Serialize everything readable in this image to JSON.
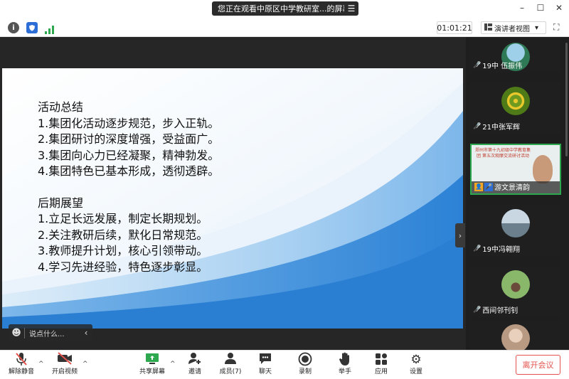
{
  "titlebar": {
    "share_text": "您正在观看中原区中学教研室...的屏幕",
    "menu_icon": "☰",
    "minimize": "–",
    "restore": "☐",
    "close": "✕"
  },
  "infobar": {
    "info_label": "i",
    "timer": "01:01:21",
    "view_label": "演讲者视图",
    "view_caret": "▾",
    "fullscreen": "⛶"
  },
  "slide": {
    "lines": [
      "活动总结",
      "1.集团化活动逐步规范，步入正轨。",
      "2.集团研讨的深度增强，受益面广。",
      "3.集团向心力已经凝聚，精神勃发。",
      "4.集团特色已基本形成，透彻透辟。",
      "后期展望",
      "1.立足长远发展，制定长期规划。",
      "2.关注教研后续，默化日常规范。",
      "3.教师提升计划，核心引领带动。",
      "4.学习先进经验，特色逐步彰显。"
    ],
    "colors": {
      "wave_light": "#dcecf8",
      "wave_mid": "#8ec3ee",
      "wave_dark": "#3b8fdd"
    }
  },
  "chat": {
    "placeholder": "说点什么...",
    "face_icon": "☻",
    "collapse_icon": "‹"
  },
  "gallery": {
    "handle_icon": "›",
    "tiles": [
      {
        "name": "19中 伍振伟",
        "avatar_color": "#2f7a56"
      },
      {
        "name": "21中张军辉",
        "avatar_color": "#6f9a20"
      },
      {
        "name": "游文景清韵",
        "active": true
      },
      {
        "name": "19中冯翱翔",
        "avatar_color": "#6b7f8d"
      },
      {
        "name": "西间邻刊钊",
        "avatar_color": "#8ab86a"
      },
      {
        "name": "",
        "avatar_color": "#b89a82"
      }
    ],
    "active_tile_banner": "郑州市第十九初级中学教育集团 第五次观摩交流研讨活动"
  },
  "toolbar": {
    "items": [
      {
        "label": "解除静音",
        "icon": "🎙"
      },
      {
        "label": "开启视频",
        "icon": "▭"
      },
      {
        "label": "共享屏幕",
        "icon": "▣"
      },
      {
        "label": "邀请",
        "icon": "👤"
      },
      {
        "label": "成员(7)",
        "icon": "👥"
      },
      {
        "label": "聊天",
        "icon": "💬"
      },
      {
        "label": "录制",
        "icon": "◉"
      },
      {
        "label": "举手",
        "icon": "✋"
      },
      {
        "label": "应用",
        "icon": "▦"
      },
      {
        "label": "设置",
        "icon": "⚙"
      }
    ],
    "caret": "^",
    "leave_label": "离开会议"
  }
}
